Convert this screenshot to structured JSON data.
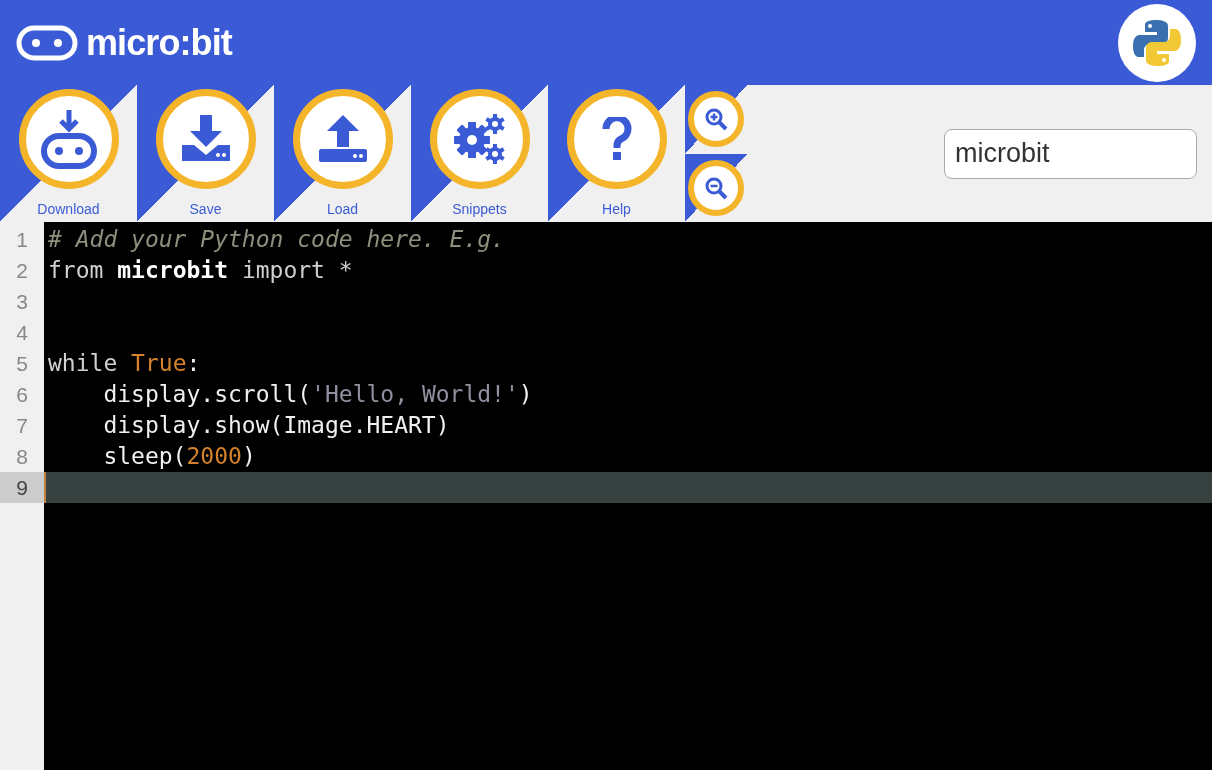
{
  "header": {
    "logo_text": "micro:bit"
  },
  "toolbar": {
    "buttons": [
      {
        "label": "Download",
        "kind": "download"
      },
      {
        "label": "Save",
        "kind": "save"
      },
      {
        "label": "Load",
        "kind": "load"
      },
      {
        "label": "Snippets",
        "kind": "snippets"
      },
      {
        "label": "Help",
        "kind": "help"
      }
    ],
    "zoom_buttons": [
      {
        "kind": "zoom-in"
      },
      {
        "kind": "zoom-out"
      }
    ],
    "script_name": {
      "value": "microbit"
    }
  },
  "editor": {
    "lines": [
      {
        "number": "1",
        "selected": false,
        "tokens": [
          {
            "text": "# Add your Python code here. E.g.",
            "kind": "comment"
          }
        ]
      },
      {
        "number": "2",
        "selected": false,
        "tokens": [
          {
            "text": "from ",
            "kind": "keyword"
          },
          {
            "text": "microbit",
            "kind": "module"
          },
          {
            "text": " import *",
            "kind": "keyword"
          }
        ]
      },
      {
        "number": "3",
        "selected": false
      },
      {
        "number": "4",
        "selected": false
      },
      {
        "number": "5",
        "selected": false,
        "tokens": [
          {
            "text": "while ",
            "kind": "keyword"
          },
          {
            "text": "True",
            "kind": "constant"
          },
          {
            "text": ":",
            "kind": "plain"
          }
        ]
      },
      {
        "number": "6",
        "selected": false,
        "tokens": [
          {
            "text": "    display.scroll(",
            "kind": "plain"
          },
          {
            "text": "'Hello, World!'",
            "kind": "string"
          },
          {
            "text": ")",
            "kind": "plain"
          }
        ]
      },
      {
        "number": "7",
        "selected": false,
        "tokens": [
          {
            "text": "    display.show(Image.HEART)",
            "kind": "plain"
          }
        ]
      },
      {
        "number": "8",
        "selected": false,
        "tokens": [
          {
            "text": "    sleep(",
            "kind": "plain"
          },
          {
            "text": "2000",
            "kind": "constant"
          },
          {
            "text": ")",
            "kind": "plain"
          }
        ]
      },
      {
        "number": "9",
        "selected": true
      }
    ]
  }
}
